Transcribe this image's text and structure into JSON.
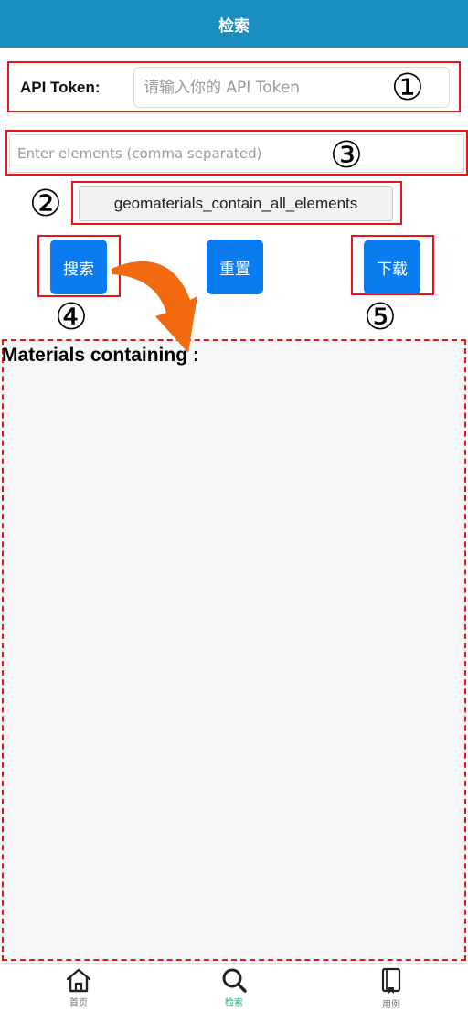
{
  "header": {
    "title": "检索"
  },
  "api_token": {
    "label": "API Token:",
    "placeholder": "请输入你的 API Token",
    "value": ""
  },
  "elements_input": {
    "placeholder": "Enter elements (comma separated)",
    "value": ""
  },
  "function_selector": {
    "value": "geomaterials_contain_all_elements"
  },
  "buttons": {
    "search": "搜索",
    "reset": "重置",
    "download": "下载"
  },
  "annotations": {
    "n1": "①",
    "n2": "②",
    "n3": "③",
    "n4": "④",
    "n5": "⑤"
  },
  "results": {
    "title": "Materials containing :"
  },
  "tabbar": {
    "items": [
      {
        "label": "首页",
        "icon": "home-icon"
      },
      {
        "label": "检索",
        "icon": "search-icon",
        "active": true
      },
      {
        "label": "用例",
        "icon": "book-icon"
      }
    ]
  },
  "colors": {
    "header": "#1a8fbf",
    "primary_button": "#0a7cf0",
    "annotation": "#e8141b",
    "arrow": "#f26a10",
    "active_tab": "#1aad6e"
  }
}
